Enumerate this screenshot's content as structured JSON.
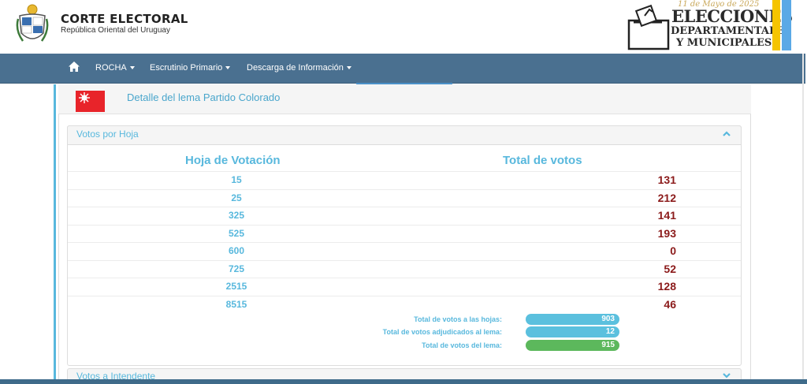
{
  "brand": {
    "title": "CORTE ELECTORAL",
    "subtitle": "República Oriental del Uruguay"
  },
  "elections_banner": {
    "date": "11 de Mayo de 2025",
    "line1": "ELECCIONES",
    "line2": "DEPARTAMENTALES",
    "line3": "Y MUNICIPALES"
  },
  "navbar": {
    "home_icon": "home-icon",
    "items": [
      {
        "label": "ROCHA"
      },
      {
        "label": "Escrutinio Primario"
      },
      {
        "label": "Descarga de Información"
      }
    ]
  },
  "lema": {
    "title": "Detalle del lema Partido Colorado"
  },
  "votos_por_hoja": {
    "title": "Votos por Hoja",
    "col_hoja": "Hoja de Votación",
    "col_total": "Total de votos",
    "rows": [
      {
        "hoja": "15",
        "total": "131"
      },
      {
        "hoja": "25",
        "total": "212"
      },
      {
        "hoja": "325",
        "total": "141"
      },
      {
        "hoja": "525",
        "total": "193"
      },
      {
        "hoja": "600",
        "total": "0"
      },
      {
        "hoja": "725",
        "total": "52"
      },
      {
        "hoja": "2515",
        "total": "128"
      },
      {
        "hoja": "8515",
        "total": "46"
      }
    ],
    "summary": [
      {
        "label": "Total de votos a las hojas:",
        "value": "903"
      },
      {
        "label": "Total de votos adjudicados al lema:",
        "value": "12"
      },
      {
        "label": "Total de votos del lema:",
        "value": "915"
      }
    ]
  },
  "votos_intendente": {
    "title": "Votos a Intendente"
  },
  "colors": {
    "navbar": "#4a7090",
    "accent": "#58b8dd",
    "totals": "#8b1a1a",
    "pill_blue": "#5bc0de",
    "pill_green": "#5cb85c"
  }
}
